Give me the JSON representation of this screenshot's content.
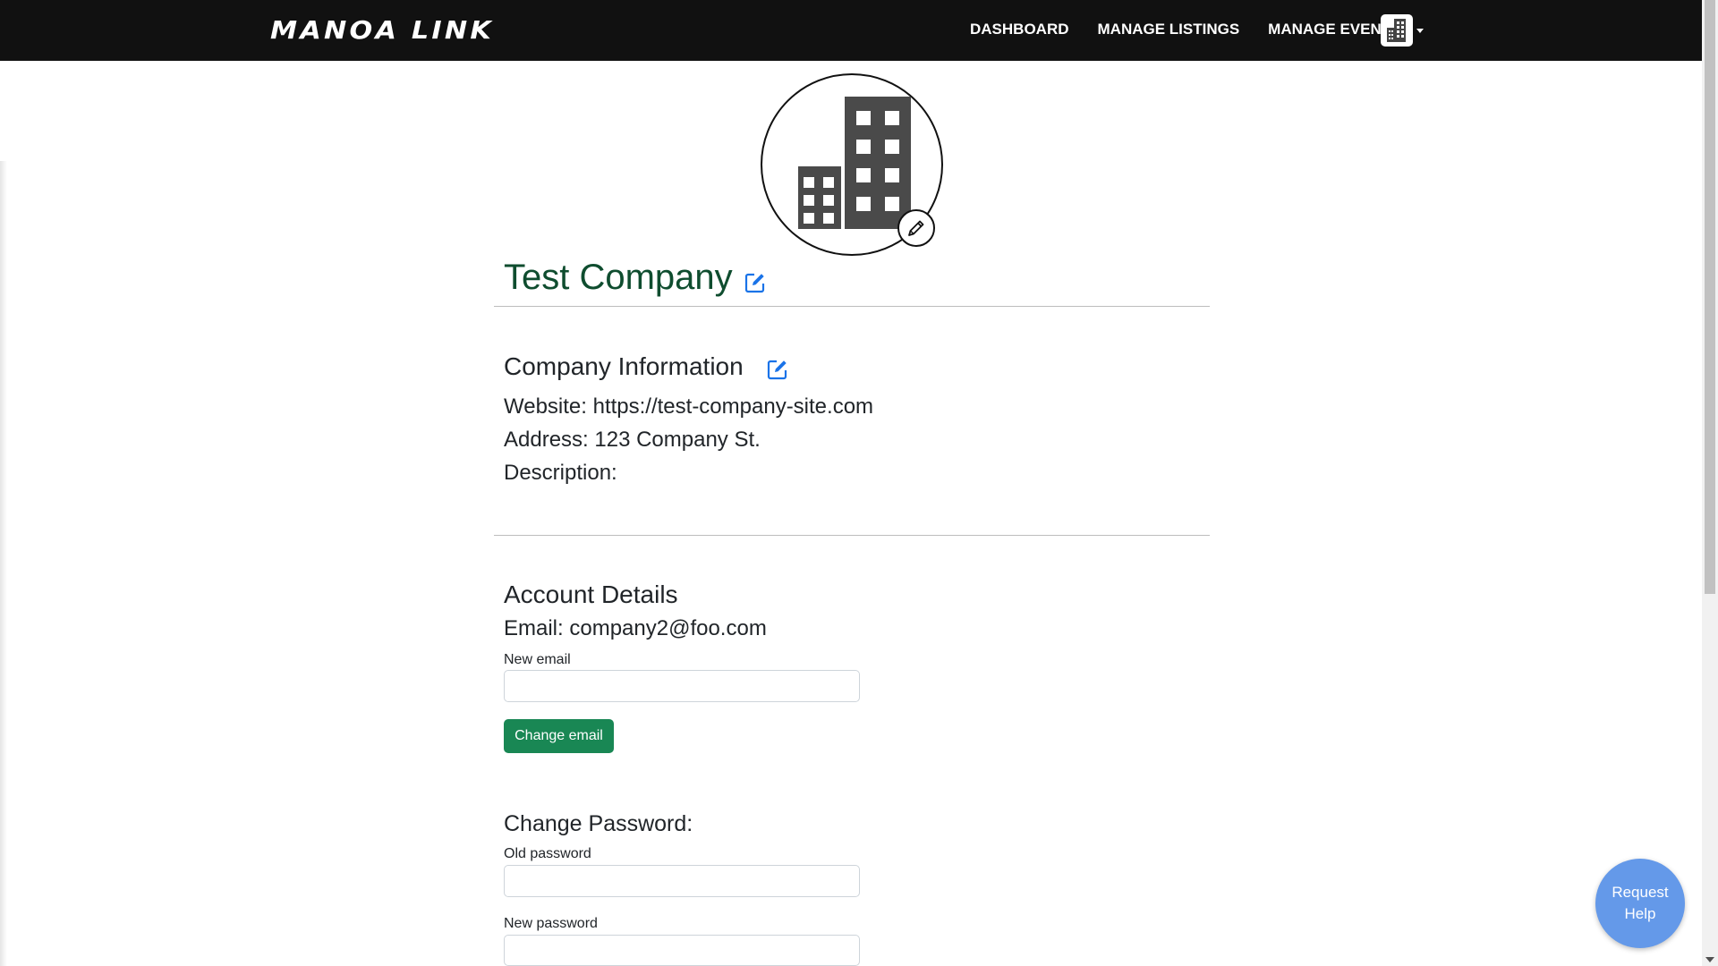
{
  "brand": {
    "name": "MANOA LINK"
  },
  "nav": {
    "links": [
      "DASHBOARD",
      "MANAGE LISTINGS",
      "MANAGE EVENTS"
    ],
    "user_icon": "building-icon",
    "dropdown_icon": "caret-down-icon"
  },
  "profile": {
    "avatar_icon": "building-icon",
    "edit_photo_icon": "pencil-icon",
    "company_name": "Test Company",
    "edit_icon": "edit-square-icon"
  },
  "company_info": {
    "title": "Company Information",
    "website": "Website: https://test-company-site.com",
    "address": "Address: 123 Company St.",
    "description": "Description:"
  },
  "account": {
    "title": "Account Details",
    "email": "Email: company2@foo.com",
    "new_email_label": "New email",
    "new_email_value": "",
    "change_email_label": "Change email"
  },
  "password": {
    "title": "Change Password:",
    "old_label": "Old password",
    "new_label": "New password"
  },
  "help": {
    "label": "Request\nHelp"
  },
  "colors": {
    "navbar": "#111111",
    "company_title": "#0f4d2f",
    "edit_icon": "#1a73e8",
    "button_green": "#198754",
    "help_button": "#6499e9"
  }
}
